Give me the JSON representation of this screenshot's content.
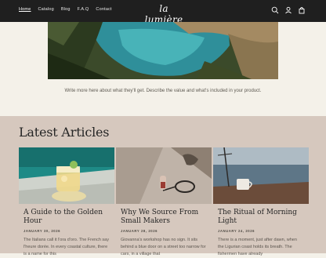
{
  "header": {
    "nav": [
      "Home",
      "Catalog",
      "Blog",
      "F.A.Q",
      "Contact"
    ],
    "active_nav": "Home",
    "logo": "la lumière",
    "icons": [
      "search-icon",
      "account-icon",
      "cart-icon"
    ]
  },
  "hero": {
    "description": "Write more here about what they'll get. Describe the value and what's included in your product."
  },
  "articles": {
    "heading": "Latest Articles",
    "items": [
      {
        "title": "A Guide to the Golden Hour",
        "date": "JANUARY 30, 2026",
        "excerpt": "The Italians call it l'ora d'oro. The French say l'heure dorée. In every coastal culture, there is a name for this"
      },
      {
        "title": "Why We Source From Small Makers",
        "date": "JANUARY 28, 2026",
        "excerpt": "Giovanna's workshop has no sign. It sits behind a blue door on a street too narrow for cars, in a village that"
      },
      {
        "title": "The Ritual of Morning Light",
        "date": "JANUARY 24, 2026",
        "excerpt": "There is a moment, just after dawn, when the Ligurian coast holds its breath. The fishermen have already"
      }
    ]
  }
}
